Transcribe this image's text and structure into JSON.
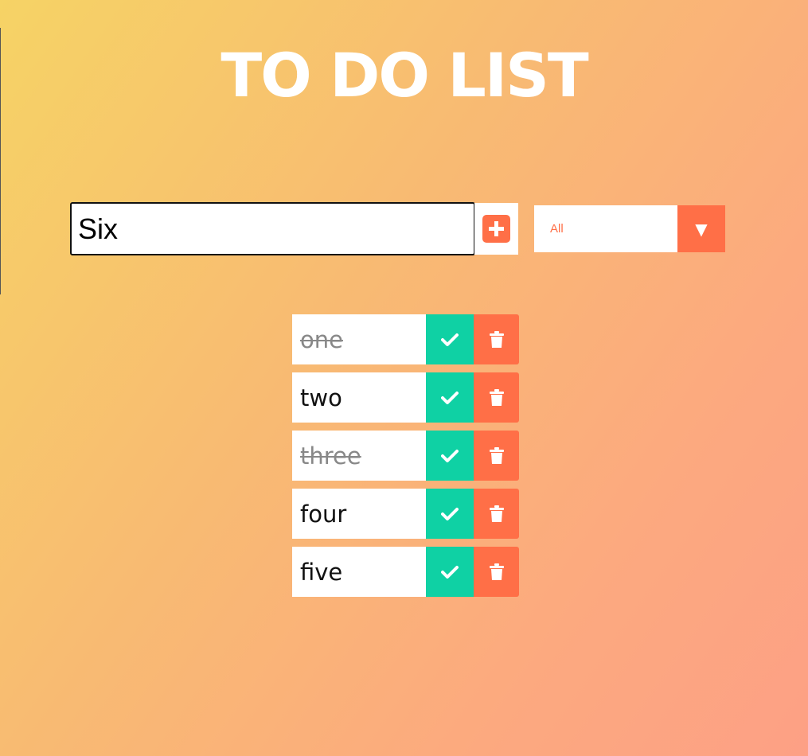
{
  "title": "TO DO LIST",
  "input": {
    "value": "Six"
  },
  "add_button": {
    "icon": "plus-square-icon"
  },
  "filter": {
    "selected": "All",
    "arrow": "▼"
  },
  "todos": [
    {
      "label": "one",
      "completed": true
    },
    {
      "label": "two",
      "completed": false
    },
    {
      "label": "three",
      "completed": true
    },
    {
      "label": "four",
      "completed": false
    },
    {
      "label": "five",
      "completed": false
    }
  ],
  "colors": {
    "accent": "#ff6f47",
    "check": "#0fd1a4",
    "gradient_start": "#f6d365",
    "gradient_end": "#fda085"
  }
}
